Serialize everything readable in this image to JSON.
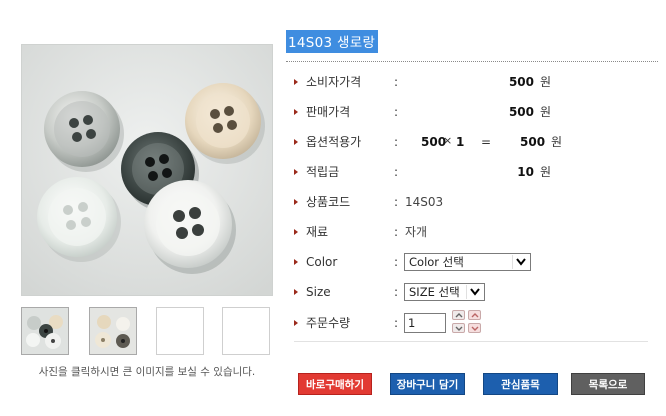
{
  "product": {
    "title": "14S03 생로랑",
    "image_hint": "사진을 클릭하시면 큰 이미지를 보실 수 있습니다."
  },
  "info": {
    "consumer_price": {
      "label": "소비자가격",
      "value": "500",
      "unit": "원"
    },
    "sale_price": {
      "label": "판매가격",
      "value": "500",
      "unit": "원"
    },
    "option_price": {
      "label": "옵션적용가",
      "qty_value": "500",
      "times": "×",
      "multiplier": "1",
      "equals": "=",
      "value": "500",
      "unit": "원"
    },
    "points": {
      "label": "적립금",
      "value": "10",
      "unit": "원"
    },
    "product_code": {
      "label": "상품코드",
      "value": "14S03"
    },
    "material": {
      "label": "재료",
      "value": "자개"
    },
    "color": {
      "label": "Color",
      "selected": "Color 선택"
    },
    "size": {
      "label": "Size",
      "selected": "SIZE 선택"
    },
    "quantity": {
      "label": "주문수량",
      "value": "1"
    },
    "colon": ":"
  },
  "buttons": {
    "buy_now": "바로구매하기",
    "add_cart": "장바구니 담기",
    "wishlist": "관심품목",
    "to_list": "목록으로"
  },
  "colors": {
    "title_bg": "#3f8de0",
    "buy_button": "#e23a33",
    "cart_button": "#1d5fae",
    "list_button": "#606060",
    "bullet": "#9b2a1c"
  }
}
